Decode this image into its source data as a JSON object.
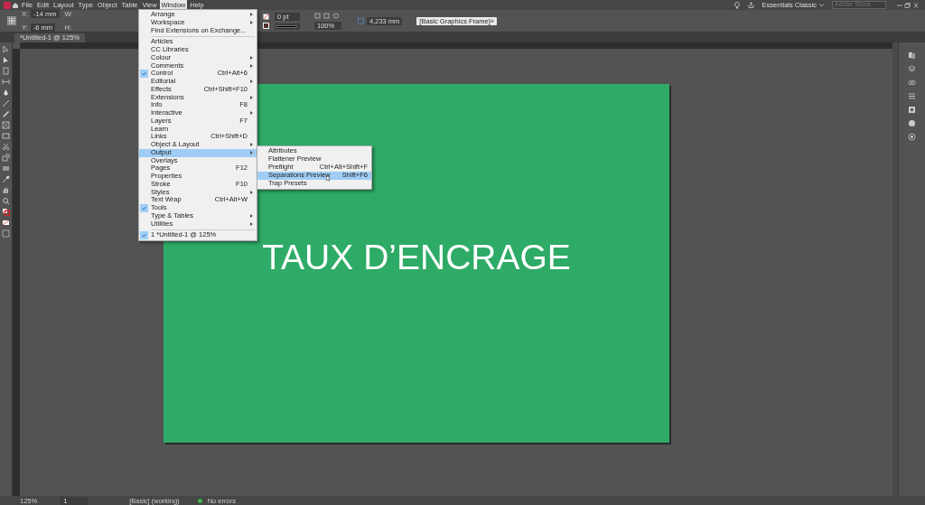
{
  "menu_bar": [
    {
      "label": "File",
      "selected": false
    },
    {
      "label": "Edit",
      "selected": false
    },
    {
      "label": "Layout",
      "selected": false
    },
    {
      "label": "Type",
      "selected": false
    },
    {
      "label": "Object",
      "selected": false
    },
    {
      "label": "Table",
      "selected": false
    },
    {
      "label": "View",
      "selected": false
    },
    {
      "label": "Window",
      "selected": true
    },
    {
      "label": "Help",
      "selected": false
    }
  ],
  "workspace": "Essentials Classic",
  "search": {
    "placeholder": "Adobe Stock"
  },
  "control_bar": {
    "x_label": "X:",
    "x": "-14 mm",
    "y_label": "Y:",
    "y": "-6 mm",
    "w_label": "W:",
    "h_label": "H:",
    "stroke_weight": "0 pt",
    "opacity": "100%",
    "gap": "4,233 mm",
    "object_style": "[Basic Graphics Frame]+"
  },
  "document_tab": "*Untitled-1 @ 125%",
  "page_text": "TAUX D’ENCRAGE",
  "window_menu": [
    {
      "kind": "item",
      "label": "Arrange",
      "submenu": true,
      "checked": false,
      "selected": false
    },
    {
      "kind": "item",
      "label": "Workspace",
      "submenu": true,
      "checked": false,
      "selected": false
    },
    {
      "kind": "item",
      "label": "Find Extensions on Exchange...",
      "checked": false,
      "selected": false
    },
    {
      "kind": "separator"
    },
    {
      "kind": "item",
      "label": "Articles",
      "checked": false,
      "selected": false
    },
    {
      "kind": "item",
      "label": "CC Libraries",
      "checked": false,
      "selected": false
    },
    {
      "kind": "item",
      "label": "Colour",
      "submenu": true,
      "checked": false,
      "selected": false
    },
    {
      "kind": "item",
      "label": "Comments",
      "submenu": true,
      "checked": false,
      "selected": false
    },
    {
      "kind": "item",
      "label": "Control",
      "shortcut": "Ctrl+Alt+6",
      "checked": true,
      "selected": false
    },
    {
      "kind": "item",
      "label": "Editorial",
      "submenu": true,
      "checked": false,
      "selected": false
    },
    {
      "kind": "item",
      "label": "Effects",
      "shortcut": "Ctrl+Shift+F10",
      "checked": false,
      "selected": false
    },
    {
      "kind": "item",
      "label": "Extensions",
      "submenu": true,
      "checked": false,
      "selected": false
    },
    {
      "kind": "item",
      "label": "Info",
      "shortcut": "F8",
      "checked": false,
      "selected": false
    },
    {
      "kind": "item",
      "label": "Interactive",
      "submenu": true,
      "checked": false,
      "selected": false
    },
    {
      "kind": "item",
      "label": "Layers",
      "shortcut": "F7",
      "checked": false,
      "selected": false
    },
    {
      "kind": "item",
      "label": "Learn",
      "checked": false,
      "selected": false
    },
    {
      "kind": "item",
      "label": "Links",
      "shortcut": "Ctrl+Shift+D",
      "checked": false,
      "selected": false
    },
    {
      "kind": "item",
      "label": "Object & Layout",
      "submenu": true,
      "checked": false,
      "selected": false
    },
    {
      "kind": "item",
      "label": "Output",
      "submenu": true,
      "checked": false,
      "selected": true
    },
    {
      "kind": "item",
      "label": "Overlays",
      "checked": false,
      "selected": false
    },
    {
      "kind": "item",
      "label": "Pages",
      "shortcut": "F12",
      "checked": false,
      "selected": false
    },
    {
      "kind": "item",
      "label": "Properties",
      "checked": false,
      "selected": false
    },
    {
      "kind": "item",
      "label": "Stroke",
      "shortcut": "F10",
      "checked": false,
      "selected": false
    },
    {
      "kind": "item",
      "label": "Styles",
      "submenu": true,
      "checked": false,
      "selected": false
    },
    {
      "kind": "item",
      "label": "Text Wrap",
      "shortcut": "Ctrl+Alt+W",
      "checked": false,
      "selected": false
    },
    {
      "kind": "item",
      "label": "Tools",
      "checked": true,
      "selected": false
    },
    {
      "kind": "item",
      "label": "Type & Tables",
      "submenu": true,
      "checked": false,
      "selected": false
    },
    {
      "kind": "item",
      "label": "Utilities",
      "submenu": true,
      "checked": false,
      "selected": false
    },
    {
      "kind": "separator"
    },
    {
      "kind": "item",
      "label": "1 *Untitled-1 @ 125%",
      "checked": true,
      "selected": false
    }
  ],
  "output_submenu": [
    {
      "label": "Attributes",
      "selected": false
    },
    {
      "label": "Flattener Preview",
      "selected": false
    },
    {
      "label": "Preflight",
      "shortcut": "Ctrl+Alt+Shift+F",
      "selected": false
    },
    {
      "label": "Separations Preview",
      "shortcut": "Shift+F6",
      "selected": true
    },
    {
      "label": "Trap Presets",
      "selected": false
    }
  ],
  "status_bar": {
    "zoom": "125%",
    "page": "1",
    "profile": "[Basic] (working)",
    "preflight": "No errors"
  }
}
